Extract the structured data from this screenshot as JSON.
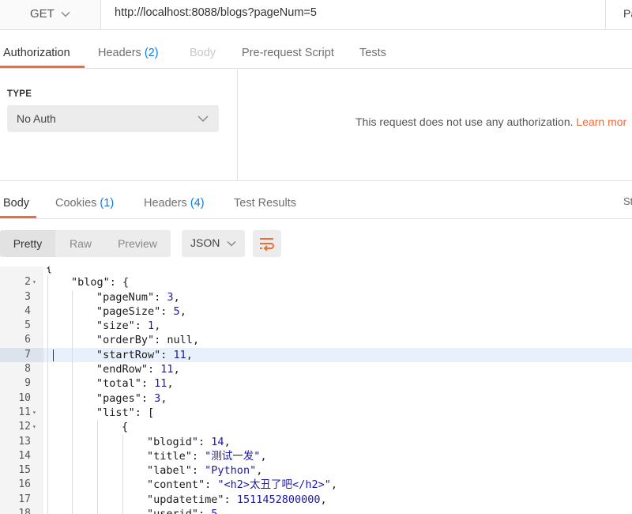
{
  "request": {
    "method": "GET",
    "url": "http://localhost:8088/blogs?pageNum=5",
    "params_label": "Par"
  },
  "request_tabs": [
    {
      "label": "Authorization",
      "count": "",
      "state": "active"
    },
    {
      "label": "Headers",
      "count": "(2)",
      "state": "normal"
    },
    {
      "label": "Body",
      "count": "",
      "state": "disabled"
    },
    {
      "label": "Pre-request Script",
      "count": "",
      "state": "normal"
    },
    {
      "label": "Tests",
      "count": "",
      "state": "normal"
    }
  ],
  "auth": {
    "type_label": "TYPE",
    "type_value": "No Auth",
    "message": "This request does not use any authorization.",
    "learn_more": "Learn mor"
  },
  "response_tabs": [
    {
      "label": "Body",
      "count": "",
      "state": "active"
    },
    {
      "label": "Cookies",
      "count": "(1)",
      "state": "normal"
    },
    {
      "label": "Headers",
      "count": "(4)",
      "state": "normal"
    },
    {
      "label": "Test Results",
      "count": "",
      "state": "normal"
    }
  ],
  "status_label": "St",
  "view": {
    "modes": [
      "Pretty",
      "Raw",
      "Preview"
    ],
    "active_mode": "Pretty",
    "format": "JSON",
    "wrap_icon": "wrap-lines-icon"
  },
  "colors": {
    "accent": "#f26b3a",
    "count": "#097bed",
    "json_value": "#1c1aa3"
  },
  "code_lines": [
    {
      "n": "",
      "text": "{",
      "fold": false
    },
    {
      "n": "2",
      "text": "\"blog\": {",
      "fold": true
    },
    {
      "n": "3",
      "text": "\"pageNum\": 3,",
      "fold": false
    },
    {
      "n": "4",
      "text": "\"pageSize\": 5,",
      "fold": false
    },
    {
      "n": "5",
      "text": "\"size\": 1,",
      "fold": false
    },
    {
      "n": "6",
      "text": "\"orderBy\": null,",
      "fold": false
    },
    {
      "n": "7",
      "text": "\"startRow\": 11,",
      "fold": false
    },
    {
      "n": "8",
      "text": "\"endRow\": 11,",
      "fold": false
    },
    {
      "n": "9",
      "text": "\"total\": 11,",
      "fold": false
    },
    {
      "n": "10",
      "text": "\"pages\": 3,",
      "fold": false
    },
    {
      "n": "11",
      "text": "\"list\": [",
      "fold": true
    },
    {
      "n": "12",
      "text": "{",
      "fold": true
    },
    {
      "n": "13",
      "text": "\"blogid\": 14,",
      "fold": false
    },
    {
      "n": "14",
      "text": "\"title\": \"测试一发\",",
      "fold": false
    },
    {
      "n": "15",
      "text": "\"label\": \"Python\",",
      "fold": false
    },
    {
      "n": "16",
      "text": "\"content\": \"<h2>太丑了吧</h2>\",",
      "fold": false
    },
    {
      "n": "17",
      "text": "\"updatetime\": 1511452800000,",
      "fold": false
    },
    {
      "n": "18",
      "text": "\"userid\": 5,",
      "fold": false
    }
  ],
  "highlighted_line": "7"
}
